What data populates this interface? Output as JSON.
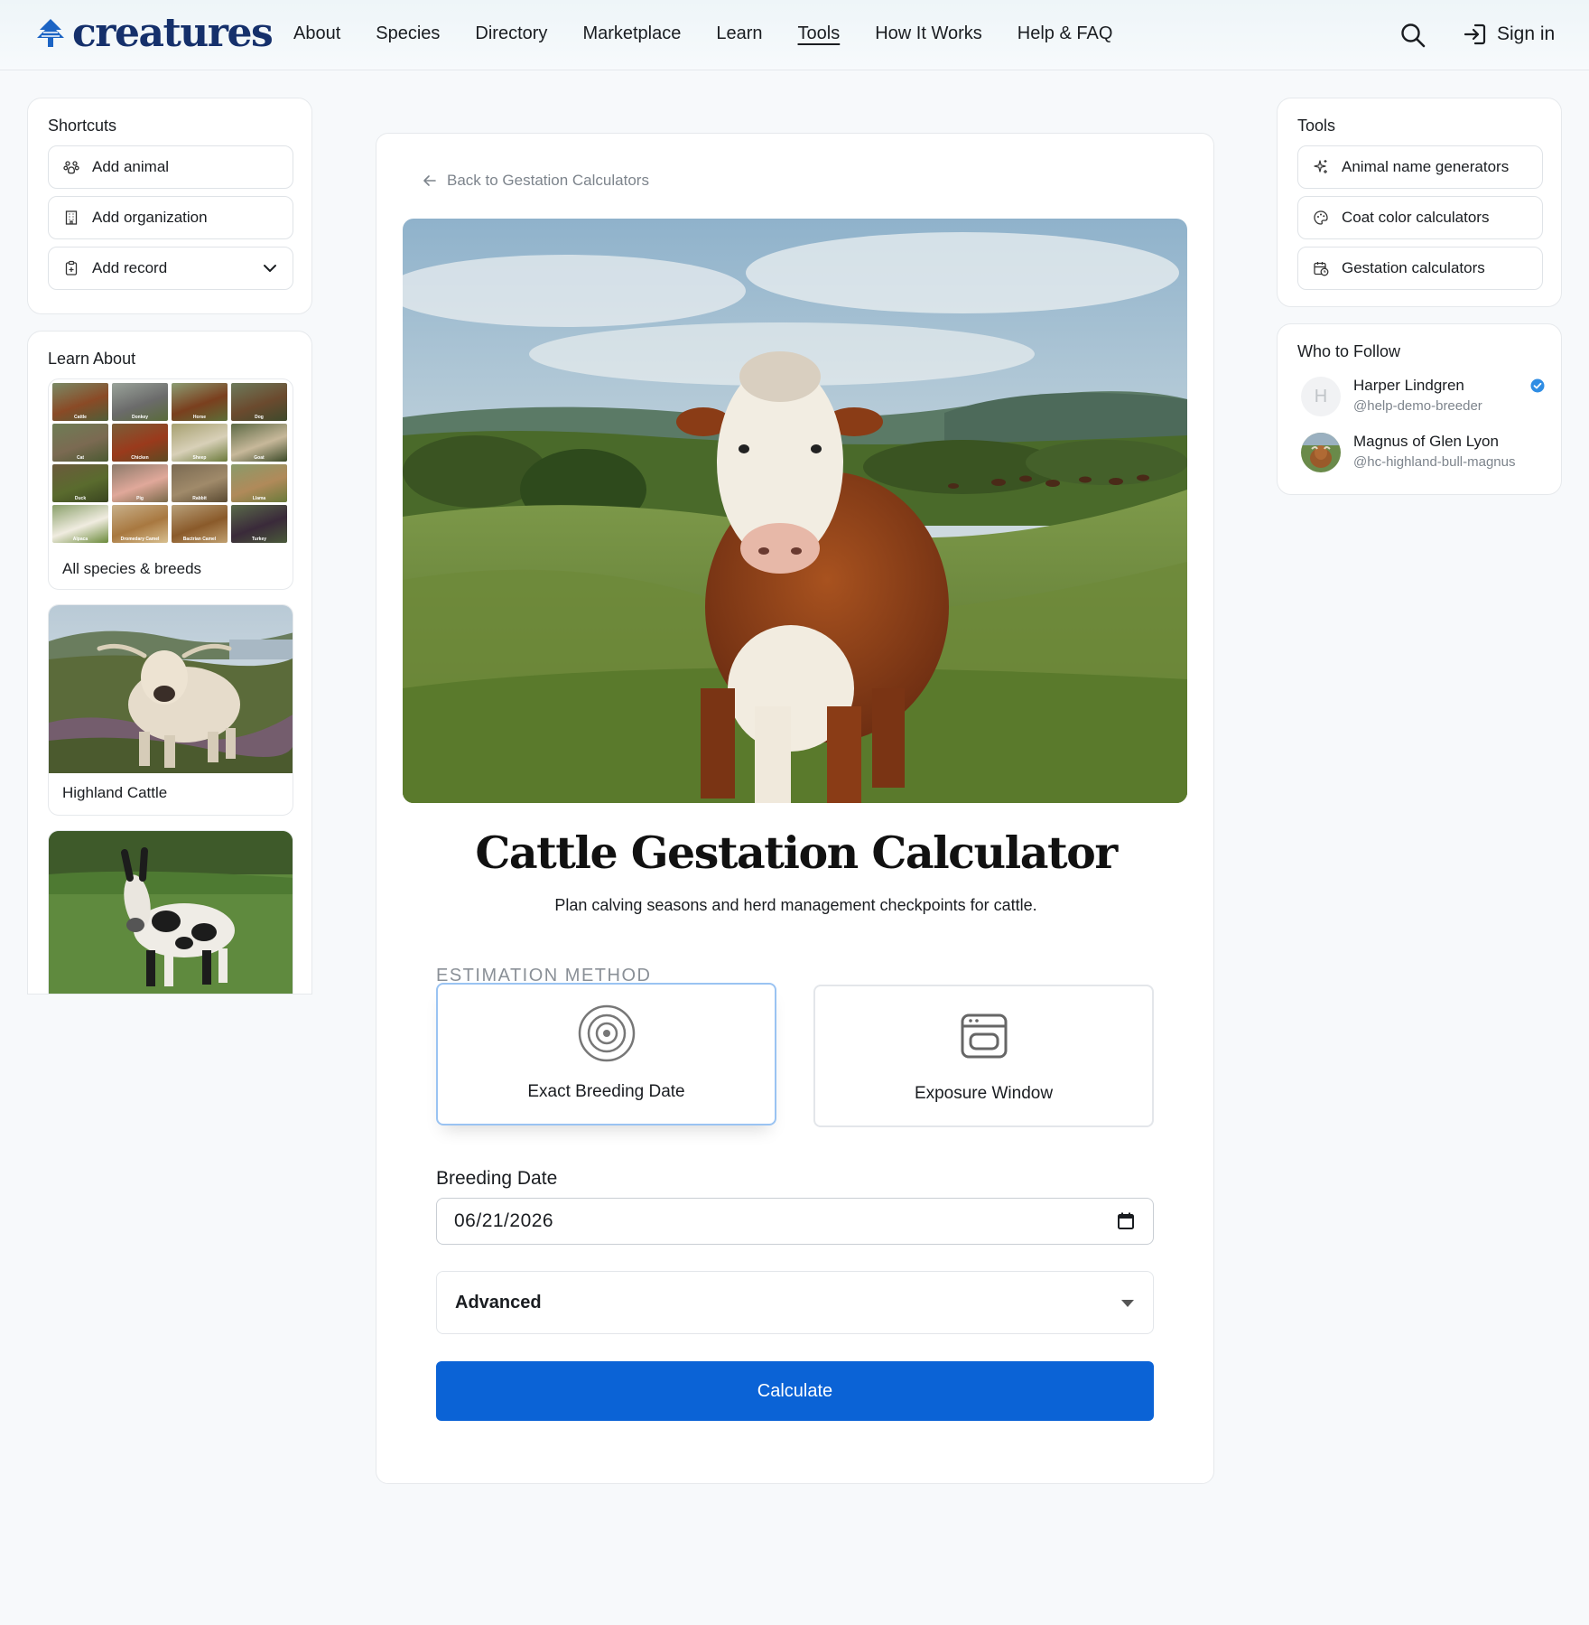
{
  "brand": {
    "name": "creatures",
    "color": "#15306b"
  },
  "nav": {
    "items": [
      {
        "label": "About"
      },
      {
        "label": "Species"
      },
      {
        "label": "Directory"
      },
      {
        "label": "Marketplace"
      },
      {
        "label": "Learn"
      },
      {
        "label": "Tools",
        "active": true
      },
      {
        "label": "How It Works"
      },
      {
        "label": "Help & FAQ"
      }
    ],
    "search_icon": "search-icon",
    "signin_label": "Sign in"
  },
  "shortcuts": {
    "title": "Shortcuts",
    "items": [
      {
        "label": "Add animal",
        "icon": "paw-icon"
      },
      {
        "label": "Add organization",
        "icon": "building-icon"
      },
      {
        "label": "Add record",
        "icon": "clipboard-plus-icon",
        "has_dropdown": true
      }
    ]
  },
  "learn": {
    "title": "Learn About",
    "grid_labels": [
      "Cattle",
      "Donkey",
      "Horse",
      "Dog",
      "Cat",
      "Chicken",
      "Sheep",
      "Goat",
      "Duck",
      "Pig",
      "Rabbit",
      "Llama",
      "Alpaca",
      "Dromedary Camel",
      "Bactrian Camel",
      "Turkey"
    ],
    "all_label": "All species & breeds",
    "cards": [
      {
        "caption": "Highland Cattle"
      },
      {
        "caption": ""
      }
    ]
  },
  "main": {
    "back_label": "Back to Gestation Calculators",
    "title": "Cattle Gestation Calculator",
    "subtitle": "Plan calving seasons and herd management checkpoints for cattle.",
    "method_label": "ESTIMATION METHOD",
    "methods": [
      {
        "label": "Exact Breeding Date",
        "icon": "target-icon",
        "selected": true
      },
      {
        "label": "Exposure Window",
        "icon": "calendar-window-icon",
        "selected": false
      }
    ],
    "breeding_date_label": "Breeding Date",
    "breeding_date_value": "06/21/2026",
    "advanced_label": "Advanced",
    "calculate_label": "Calculate",
    "accent": "#0b63d6"
  },
  "tools": {
    "title": "Tools",
    "items": [
      {
        "label": "Animal name generators",
        "icon": "sparkles-icon"
      },
      {
        "label": "Coat color calculators",
        "icon": "palette-icon"
      },
      {
        "label": "Gestation calculators",
        "icon": "calendar-clock-icon"
      }
    ]
  },
  "follow": {
    "title": "Who to Follow",
    "people": [
      {
        "name": "Harper Lindgren",
        "handle": "@help-demo-breeder",
        "avatar_initial": "H",
        "verified": true
      },
      {
        "name": "Magnus of Glen Lyon",
        "handle": "@hc-highland-bull-magnus",
        "avatar_initial": "",
        "verified": false
      }
    ]
  }
}
